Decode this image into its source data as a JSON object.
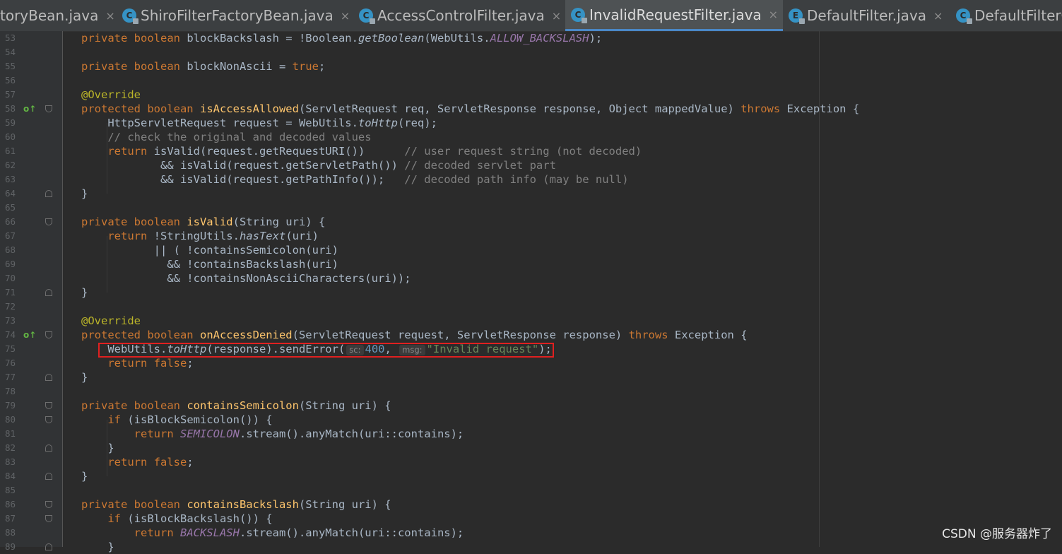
{
  "tabs": [
    {
      "label": "toryBean.java",
      "icon": "none",
      "active": false
    },
    {
      "label": "ShiroFilterFactoryBean.java",
      "icon": "class-icon",
      "active": false
    },
    {
      "label": "AccessControlFilter.java",
      "icon": "class-icon",
      "active": false
    },
    {
      "label": "InvalidRequestFilter.java",
      "icon": "class-icon",
      "active": true
    },
    {
      "label": "DefaultFilter.java",
      "icon": "enum-icon",
      "active": false
    },
    {
      "label": "DefaultFilterC",
      "icon": "class-icon",
      "active": false
    }
  ],
  "tab_close_glyph": "×",
  "icons": {
    "class_letter": "C",
    "enum_letter": "E",
    "override_marker": "o↑"
  },
  "lines": [
    {
      "n": "53",
      "tokens": [
        [
          "kw",
          "private boolean "
        ],
        [
          "",
          "blockBackslash = !Boolean."
        ],
        [
          "it",
          "getBoolean"
        ],
        [
          "",
          "(WebUtils."
        ],
        [
          "st",
          "ALLOW_BACKSLASH"
        ],
        [
          "",
          "); "
        ]
      ]
    },
    {
      "n": "54",
      "tokens": []
    },
    {
      "n": "55",
      "tokens": [
        [
          "kw",
          "private boolean "
        ],
        [
          "",
          "blockNonAscii = "
        ],
        [
          "kw",
          "true"
        ],
        [
          "",
          ";"
        ]
      ]
    },
    {
      "n": "56",
      "tokens": []
    },
    {
      "n": "57",
      "tokens": [
        [
          "an",
          "@Override"
        ]
      ]
    },
    {
      "n": "58",
      "tokens": [
        [
          "kw",
          "protected boolean "
        ],
        [
          "fn",
          "isAccessAllowed"
        ],
        [
          "",
          "(ServletRequest req, ServletResponse response, Object mappedValue) "
        ],
        [
          "kw",
          "throws "
        ],
        [
          "",
          "Exception {"
        ]
      ]
    },
    {
      "n": "59",
      "tokens": [
        [
          "",
          "    HttpServletRequest request = WebUtils."
        ],
        [
          "it",
          "toHttp"
        ],
        [
          "",
          "(req);"
        ]
      ]
    },
    {
      "n": "60",
      "tokens": [
        [
          "cm",
          "    // check the original and decoded values"
        ]
      ]
    },
    {
      "n": "61",
      "tokens": [
        [
          "kw",
          "    return "
        ],
        [
          "",
          "isValid(request.getRequestURI())      "
        ],
        [
          "cm",
          "// user request string (not decoded)"
        ]
      ]
    },
    {
      "n": "62",
      "tokens": [
        [
          "",
          "            && isValid(request.getServletPath()) "
        ],
        [
          "cm",
          "// decoded servlet part"
        ]
      ]
    },
    {
      "n": "63",
      "tokens": [
        [
          "",
          "            && isValid(request.getPathInfo());   "
        ],
        [
          "cm",
          "// decoded path info (may be null)"
        ]
      ]
    },
    {
      "n": "64",
      "tokens": [
        [
          "",
          "}"
        ]
      ]
    },
    {
      "n": "65",
      "tokens": []
    },
    {
      "n": "66",
      "tokens": [
        [
          "kw",
          "private boolean "
        ],
        [
          "fn",
          "isValid"
        ],
        [
          "",
          "(String uri) {"
        ]
      ]
    },
    {
      "n": "67",
      "tokens": [
        [
          "kw",
          "    return "
        ],
        [
          "",
          "!StringUtils."
        ],
        [
          "it",
          "hasText"
        ],
        [
          "",
          "(uri)"
        ]
      ]
    },
    {
      "n": "68",
      "tokens": [
        [
          "",
          "           || ( !containsSemicolon(uri)"
        ]
      ]
    },
    {
      "n": "69",
      "tokens": [
        [
          "",
          "             && !containsBackslash(uri)"
        ]
      ]
    },
    {
      "n": "70",
      "tokens": [
        [
          "",
          "             && !containsNonAsciiCharacters(uri));"
        ]
      ]
    },
    {
      "n": "71",
      "tokens": [
        [
          "",
          "}"
        ]
      ]
    },
    {
      "n": "72",
      "tokens": []
    },
    {
      "n": "73",
      "tokens": [
        [
          "an",
          "@Override"
        ]
      ]
    },
    {
      "n": "74",
      "tokens": [
        [
          "kw",
          "protected boolean "
        ],
        [
          "fn",
          "onAccessDenied"
        ],
        [
          "",
          "(ServletRequest request, ServletResponse response) "
        ],
        [
          "kw",
          "throws "
        ],
        [
          "",
          "Exception {"
        ]
      ]
    },
    {
      "n": "75",
      "tokens": [
        [
          "",
          "    WebUtils."
        ],
        [
          "it",
          "toHttp"
        ],
        [
          "",
          "(response).sendError("
        ],
        [
          "hint",
          "sc:"
        ],
        [
          "nm",
          "400"
        ],
        [
          "",
          ", "
        ],
        [
          "hint",
          "msg:"
        ],
        [
          "str",
          "\"Invalid request\""
        ],
        [
          "",
          ");"
        ]
      ]
    },
    {
      "n": "76",
      "tokens": [
        [
          "kw",
          "    return false"
        ],
        [
          "",
          ";"
        ]
      ]
    },
    {
      "n": "77",
      "tokens": [
        [
          "",
          "}"
        ]
      ]
    },
    {
      "n": "78",
      "tokens": []
    },
    {
      "n": "79",
      "tokens": [
        [
          "kw",
          "private boolean "
        ],
        [
          "fn",
          "containsSemicolon"
        ],
        [
          "",
          "(String uri) {"
        ]
      ]
    },
    {
      "n": "80",
      "tokens": [
        [
          "kw",
          "    if "
        ],
        [
          "",
          "(isBlockSemicolon()) {"
        ]
      ]
    },
    {
      "n": "81",
      "tokens": [
        [
          "kw",
          "        return "
        ],
        [
          "st",
          "SEMICOLON"
        ],
        [
          "",
          ".stream().anyMatch(uri::contains);"
        ]
      ]
    },
    {
      "n": "82",
      "tokens": [
        [
          "",
          "    }"
        ]
      ]
    },
    {
      "n": "83",
      "tokens": [
        [
          "kw",
          "    return false"
        ],
        [
          "",
          ";"
        ]
      ]
    },
    {
      "n": "84",
      "tokens": [
        [
          "",
          "}"
        ]
      ]
    },
    {
      "n": "85",
      "tokens": []
    },
    {
      "n": "86",
      "tokens": [
        [
          "kw",
          "private boolean "
        ],
        [
          "fn",
          "containsBackslash"
        ],
        [
          "",
          "(String uri) {"
        ]
      ]
    },
    {
      "n": "87",
      "tokens": [
        [
          "kw",
          "    if "
        ],
        [
          "",
          "(isBlockBackslash()) {"
        ]
      ]
    },
    {
      "n": "88",
      "tokens": [
        [
          "kw",
          "        return "
        ],
        [
          "st",
          "BACKSLASH"
        ],
        [
          "",
          ".stream().anyMatch(uri::contains);"
        ]
      ]
    },
    {
      "n": "89",
      "tokens": [
        [
          "",
          "    }"
        ]
      ]
    }
  ],
  "watermark": "CSDN @服务器炸了",
  "colors": {
    "background": "#2b2b2b",
    "keyword": "#cc7832",
    "method_decl": "#ffc66d",
    "static_field": "#9876aa",
    "comment": "#808080",
    "annotation": "#bbb529",
    "number": "#6897bb",
    "string": "#6a8759",
    "highlight_box": "#e02020",
    "active_tab_underline": "#4a88c7"
  }
}
